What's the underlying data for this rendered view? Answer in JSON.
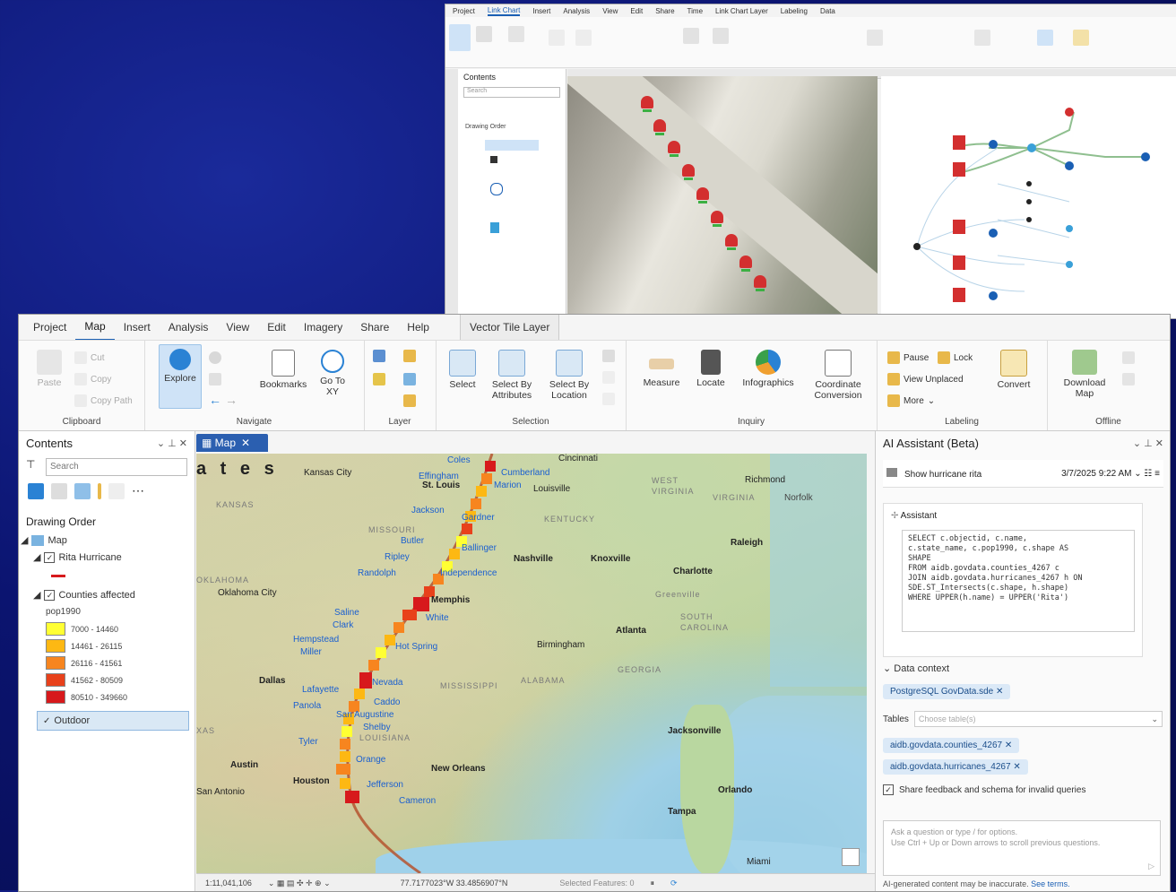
{
  "back_window": {
    "tabs": [
      "Project",
      "Link Chart",
      "Insert",
      "Analysis",
      "View",
      "Edit",
      "Share",
      "Time",
      "Link Chart Layer",
      "Labeling",
      "Data"
    ],
    "contents_title": "Contents",
    "search_placeholder": "Search",
    "drawing_order": "Drawing Order"
  },
  "menu": {
    "tabs": [
      "Project",
      "Map",
      "Insert",
      "Analysis",
      "View",
      "Edit",
      "Imagery",
      "Share",
      "Help"
    ],
    "active": "Map",
    "context_tab": "Vector Tile Layer"
  },
  "ribbon": {
    "clipboard": {
      "label": "Clipboard",
      "paste": "Paste",
      "cut": "Cut",
      "copy": "Copy",
      "copy_path": "Copy Path"
    },
    "navigate": {
      "label": "Navigate",
      "explore": "Explore",
      "bookmarks": "Bookmarks",
      "goto": "Go To XY"
    },
    "layer": {
      "label": "Layer"
    },
    "selection": {
      "label": "Selection",
      "select": "Select",
      "by_attr": "Select By Attributes",
      "by_loc": "Select By Location"
    },
    "inquiry": {
      "label": "Inquiry",
      "measure": "Measure",
      "locate": "Locate",
      "infographics": "Infographics",
      "coord": "Coordinate Conversion"
    },
    "labeling": {
      "label": "Labeling",
      "pause": "Pause",
      "lock": "Lock",
      "view_unplaced": "View Unplaced",
      "more": "More",
      "convert": "Convert"
    },
    "offline": {
      "label": "Offline",
      "download": "Download Map"
    }
  },
  "contents": {
    "title": "Contents",
    "search_placeholder": "Search",
    "drawing_order": "Drawing Order",
    "map": "Map",
    "layer_rita": "Rita Hurricane",
    "layer_counties": "Counties affected",
    "field": "pop1990",
    "legend": [
      {
        "label": "7000 - 14460",
        "color": "#ffff33"
      },
      {
        "label": "14461 - 26115",
        "color": "#fdb813"
      },
      {
        "label": "26116 - 41561",
        "color": "#f7851f"
      },
      {
        "label": "41562 - 80509",
        "color": "#e8411b"
      },
      {
        "label": "80510 - 349660",
        "color": "#d7191c"
      }
    ],
    "outdoor": "Outdoor"
  },
  "map": {
    "tab": "Map",
    "labels": {
      "title_fragment": "a t e s",
      "kansas_city": "Kansas City",
      "kansas": "KANSAS",
      "st_louis": "St. Louis",
      "effingham": "Effingham",
      "coles": "Coles",
      "cumberland": "Cumberland",
      "marion": "Marion",
      "cincinnati": "Cincinnati",
      "louisville": "Louisville",
      "kentucky": "KENTUCKY",
      "west_virginia": "WEST VIRGINIA",
      "richmond": "Richmond",
      "virginia": "VIRGINIA",
      "norfolk": "Norfolk",
      "jackson": "Jackson",
      "gardner": "Gardner",
      "missouri": "MISSOURI",
      "butler": "Butler",
      "ripley": "Ripley",
      "randolph": "Randolph",
      "ballinger": "Ballinger",
      "nashville": "Nashville",
      "knoxville": "Knoxville",
      "raleigh": "Raleigh",
      "independence": "Independence",
      "oklahoma": "OKLAHOMA",
      "oklahoma_city": "Oklahoma City",
      "charlotte": "Charlotte",
      "greenville": "Greenville",
      "memphis": "Memphis",
      "white": "White",
      "saline": "Saline",
      "clark": "Clark",
      "south_carolina": "SOUTH CAROLINA",
      "atlanta": "Atlanta",
      "hempstead": "Hempstead",
      "miller": "Miller",
      "hot_spring": "Hot Spring",
      "birmingham": "Birmingham",
      "georgia": "GEORGIA",
      "dallas": "Dallas",
      "lafayette": "Lafayette",
      "nevada": "Nevada",
      "mississippi": "MISSISSIPPI",
      "alabama": "ALABAMA",
      "panola": "Panola",
      "caddo": "Caddo",
      "san_augustine": "San Augustine",
      "shelby": "Shelby",
      "louisiana": "LOUISIANA",
      "jacksonville": "Jacksonville",
      "tyler": "Tyler",
      "orange": "Orange",
      "austin": "Austin",
      "new_orleans": "New Orleans",
      "houston": "Houston",
      "jefferson": "Jefferson",
      "san_antonio": "San Antonio",
      "cameron": "Cameron",
      "orlando": "Orlando",
      "tampa": "Tampa",
      "texas_frag": "XAS",
      "miami": "Miami"
    }
  },
  "statusbar": {
    "scale": "1:11,041,106",
    "coords": "77.7177023°W 33.4856907°N",
    "selected": "Selected Features: 0"
  },
  "ai": {
    "title": "AI Assistant (Beta)",
    "history_item": "Show hurricane rita",
    "history_time": "3/7/2025 9:22 AM",
    "assistant_label": "Assistant",
    "sql": "SELECT c.objectid, c.name,\nc.state_name, c.pop1990, c.shape AS\nSHAPE\nFROM aidb.govdata.counties_4267 c\nJOIN aidb.govdata.hurricanes_4267 h ON\nSDE.ST_Intersects(c.shape, h.shape)\nWHERE UPPER(h.name) = UPPER('Rita')",
    "data_context": "Data context",
    "datasource": "PostgreSQL GovData.sde",
    "tables_label": "Tables",
    "tables_placeholder": "Choose table(s)",
    "table1": "aidb.govdata.counties_4267",
    "table2": "aidb.govdata.hurricanes_4267",
    "share_feedback": "Share feedback and schema for invalid queries",
    "ask_placeholder": "Ask a question or type / for options.\nUse Ctrl + Up or Down arrows to scroll previous questions.",
    "disclaimer": "AI-generated content may be inaccurate.",
    "terms": "See terms."
  }
}
